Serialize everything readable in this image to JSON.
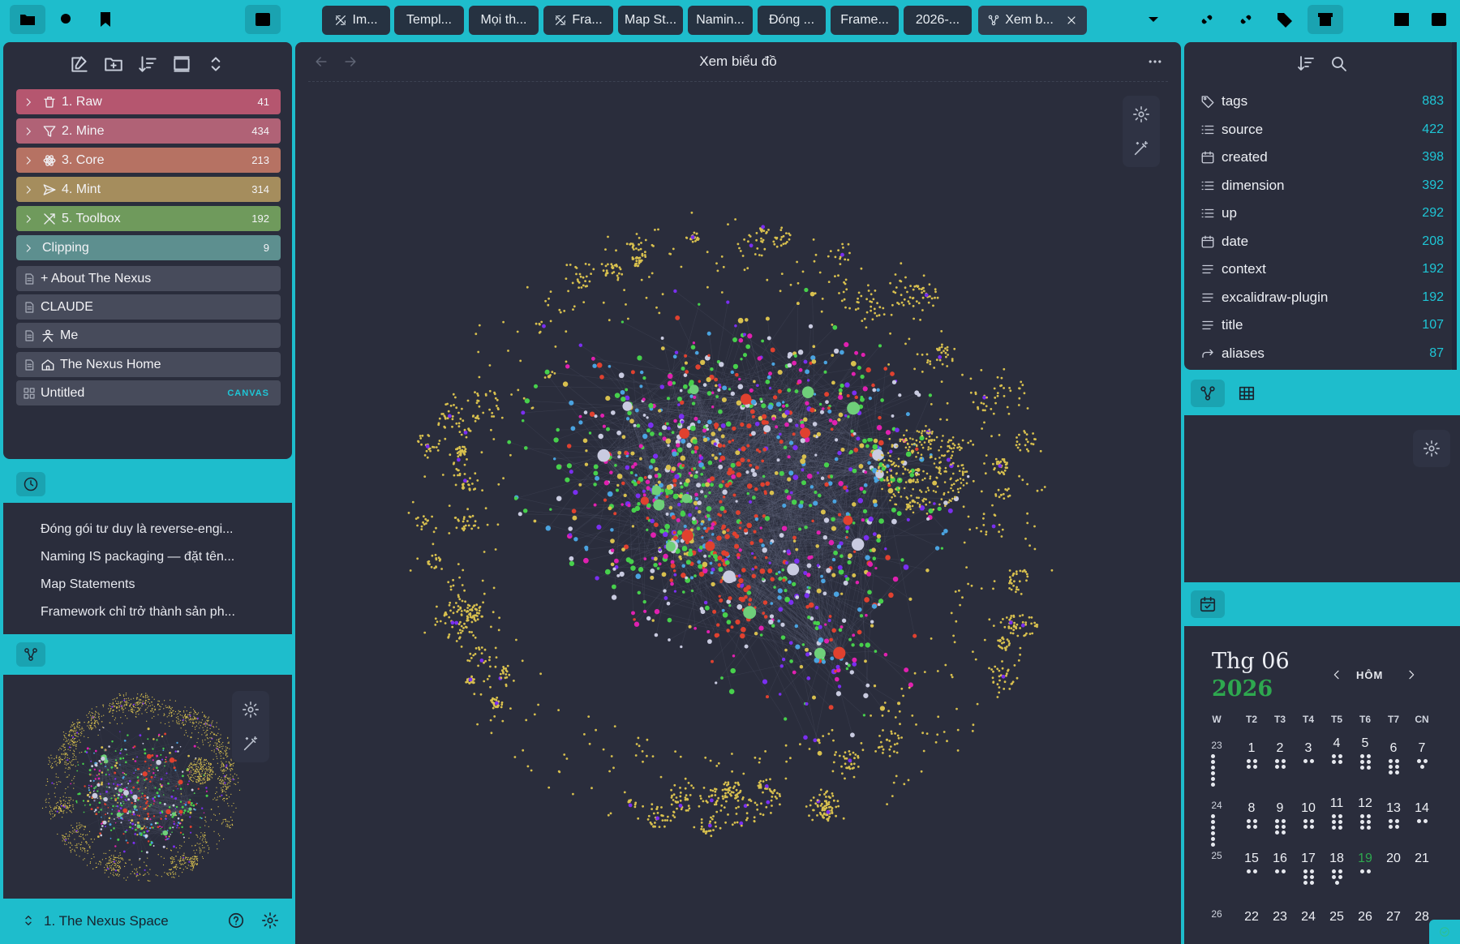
{
  "tabs": [
    {
      "label": "Im...",
      "icon": "excalidraw-icon"
    },
    {
      "label": "Templ...",
      "icon": ""
    },
    {
      "label": "Mọi th...",
      "icon": ""
    },
    {
      "label": "Fra...",
      "icon": "excalidraw-icon"
    },
    {
      "label": "Map St...",
      "icon": ""
    },
    {
      "label": "Namin...",
      "icon": ""
    },
    {
      "label": "Đóng ...",
      "icon": ""
    },
    {
      "label": "Frame...",
      "icon": ""
    },
    {
      "label": "2026-...",
      "icon": ""
    },
    {
      "label": "Xem b...",
      "icon": "graph-icon",
      "active": true
    }
  ],
  "tree": {
    "folders": [
      {
        "label": "1. Raw",
        "count": "41",
        "color": "#b5566f",
        "icon": "trash-icon"
      },
      {
        "label": "2. Mine",
        "count": "434",
        "color": "#b06276",
        "icon": "filter-icon"
      },
      {
        "label": "3. Core",
        "count": "213",
        "color": "#b67263",
        "icon": "atom-icon"
      },
      {
        "label": "4. Mint",
        "count": "314",
        "color": "#a58d5d",
        "icon": "send-icon"
      },
      {
        "label": "5. Toolbox",
        "count": "192",
        "color": "#6f9a5c",
        "icon": "tools-icon"
      },
      {
        "label": "Clipping",
        "count": "9",
        "color": "#5d8f8f",
        "icon": ""
      }
    ],
    "files": [
      {
        "label": "+ About The Nexus",
        "icon": ""
      },
      {
        "label": "CLAUDE",
        "icon": ""
      },
      {
        "label": "Me",
        "icon": "person-icon"
      },
      {
        "label": "The Nexus Home",
        "icon": "home-icon"
      },
      {
        "label": "Untitled",
        "badge": "CANVAS",
        "icon": "canvas-icon"
      }
    ]
  },
  "recent": [
    "Đóng gói tư duy là reverse-engi...",
    "Naming IS packaging — đặt tên...",
    "Map Statements",
    "Framework chỉ trở thành sản ph..."
  ],
  "vault": {
    "name": "1. The Nexus Space"
  },
  "main": {
    "title": "Xem biểu đồ"
  },
  "properties": [
    {
      "name": "tags",
      "count": "883",
      "icon": "tag-icon"
    },
    {
      "name": "source",
      "count": "422",
      "icon": "list-icon"
    },
    {
      "name": "created",
      "count": "398",
      "icon": "calendar-icon"
    },
    {
      "name": "dimension",
      "count": "392",
      "icon": "list-icon"
    },
    {
      "name": "up",
      "count": "292",
      "icon": "list-icon"
    },
    {
      "name": "date",
      "count": "208",
      "icon": "calendar-icon"
    },
    {
      "name": "context",
      "count": "192",
      "icon": "text-icon"
    },
    {
      "name": "excalidraw-plugin",
      "count": "192",
      "icon": "text-icon"
    },
    {
      "name": "title",
      "count": "107",
      "icon": "text-icon"
    },
    {
      "name": "aliases",
      "count": "87",
      "icon": "forward-icon"
    }
  ],
  "calendar": {
    "month": "Thg 06",
    "year": "2026",
    "today_label": "HÔM",
    "week_header": "W",
    "day_headers": [
      "T2",
      "T3",
      "T4",
      "T5",
      "T6",
      "T7",
      "CN"
    ],
    "weeks": [
      {
        "week": "23",
        "days": [
          "1",
          "2",
          "3",
          "4",
          "5",
          "6",
          "7"
        ]
      },
      {
        "week": "24",
        "days": [
          "8",
          "9",
          "10",
          "11",
          "12",
          "13",
          "14"
        ]
      },
      {
        "week": "25",
        "days": [
          "15",
          "16",
          "17",
          "18",
          "19",
          "20",
          "21"
        ]
      },
      {
        "week": "26",
        "days": [
          "22",
          "23",
          "24",
          "25",
          "26",
          "27",
          "28"
        ]
      }
    ],
    "today": "19",
    "accent": "#2ea84f"
  },
  "colors": {
    "panel": "#2a2d3c",
    "accent": "#1ebdcc",
    "graph_yellow": "#d8c04e",
    "graph_green": "#47d04c",
    "graph_red": "#e0412f",
    "graph_magenta": "#e020b0",
    "graph_violet": "#7a2ff0",
    "graph_white": "#c9cbe0"
  }
}
